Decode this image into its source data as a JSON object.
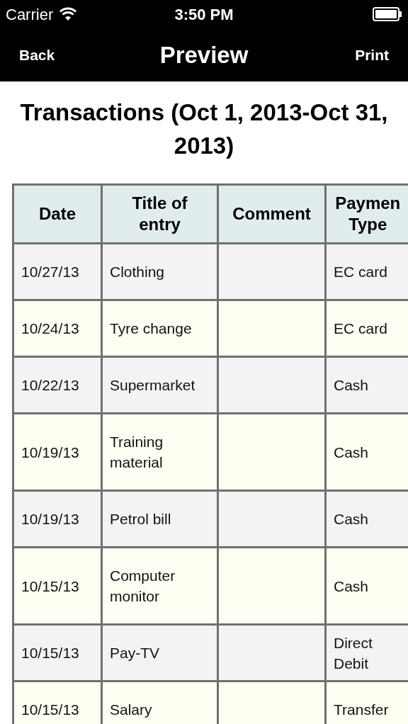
{
  "status_bar": {
    "carrier": "Carrier",
    "time": "3:50 PM"
  },
  "nav_bar": {
    "back": "Back",
    "title": "Preview",
    "action": "Print"
  },
  "heading": "Transactions (Oct 1, 2013-Oct 31, 2013)",
  "table": {
    "columns": [
      "Date",
      "Title of entry",
      "Comment",
      "Paymen Type"
    ],
    "rows": [
      {
        "date": "10/27/13",
        "title": "Clothing",
        "payment_type": "EC card"
      },
      {
        "date": "10/24/13",
        "title": "Tyre change",
        "payment_type": "EC card"
      },
      {
        "date": "10/22/13",
        "title": "Supermarket",
        "payment_type": "Cash"
      },
      {
        "date": "10/19/13",
        "title": "Training material",
        "payment_type": "Cash"
      },
      {
        "date": "10/19/13",
        "title": "Petrol bill",
        "payment_type": "Cash"
      },
      {
        "date": "10/15/13",
        "title": "Computer monitor",
        "payment_type": "Cash"
      },
      {
        "date": "10/15/13",
        "title": "Pay-TV",
        "payment_type": "Direct Debit"
      },
      {
        "date": "10/15/13",
        "title": "Salary",
        "payment_type": "Transfer"
      }
    ]
  }
}
